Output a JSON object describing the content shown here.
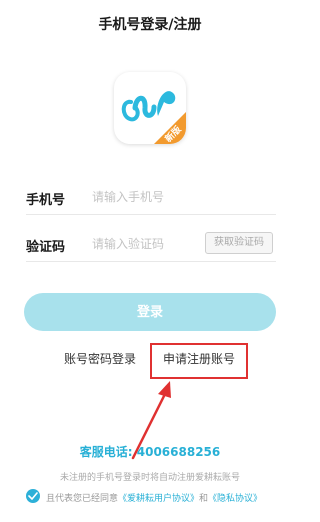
{
  "header": {
    "title": "手机号登录/注册"
  },
  "logo": {
    "badge": "新版"
  },
  "form": {
    "phone_label": "手机号",
    "phone_placeholder": "请输入手机号",
    "code_label": "验证码",
    "code_placeholder": "请输入验证码",
    "get_code_label": "获取验证码"
  },
  "actions": {
    "login_label": "登录",
    "password_login_label": "账号密码登录",
    "register_label": "申请注册账号"
  },
  "footer": {
    "service_label": "客服电话:",
    "service_phone": "4006688256",
    "notice": "未注册的手机号登录时将自动注册爱耕耘账号",
    "agree_prefix": "且代表您已经同意",
    "agreement_user": "《爱耕耘用户协议》",
    "agree_and": "和",
    "agreement_privacy": "《隐私协议》"
  },
  "colors": {
    "accent": "#28b0d6",
    "login_button": "#a8e1ec",
    "highlight_box": "#e03131",
    "badge": "#f29a2e"
  },
  "icons": [
    "app-logo-icon",
    "checkbox-checked-icon",
    "annotation-arrow-icon"
  ]
}
